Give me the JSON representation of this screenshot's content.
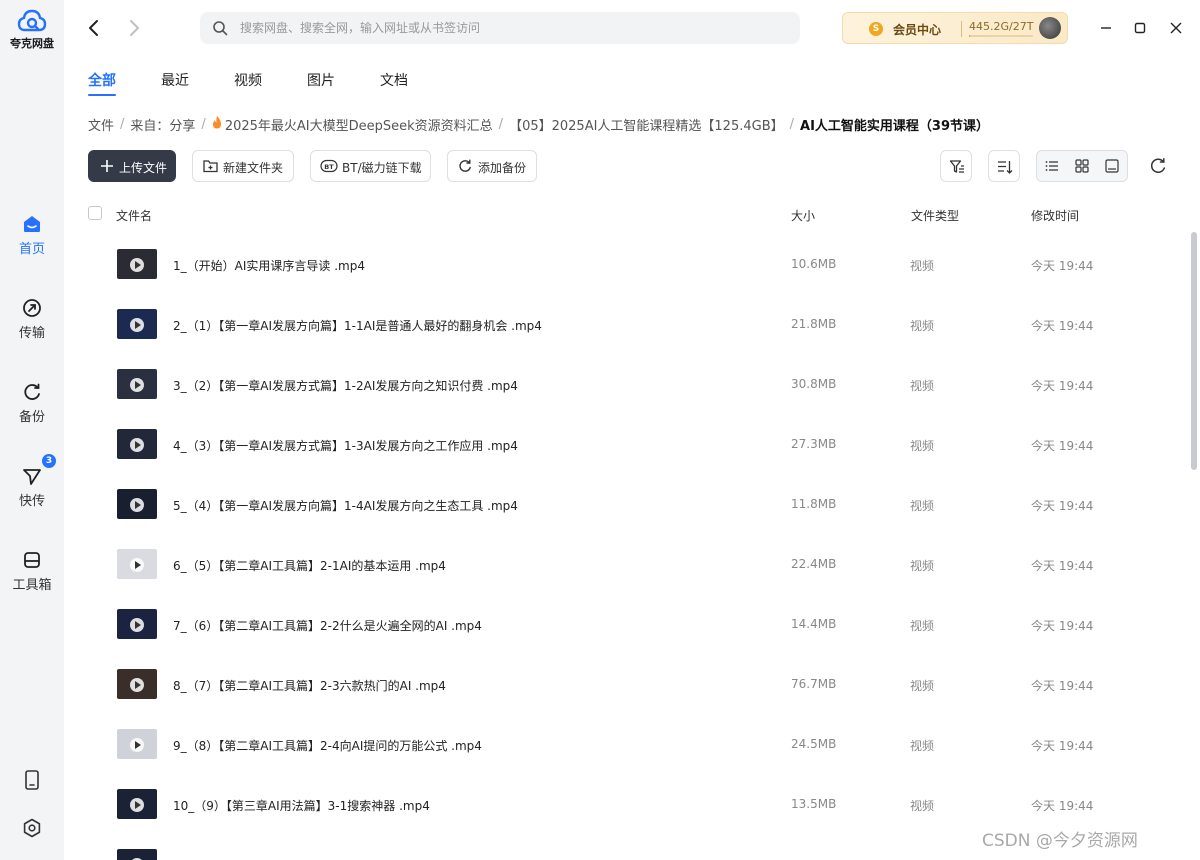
{
  "app": {
    "name": "夸克网盘"
  },
  "sidebar": {
    "items": [
      {
        "label": "首页",
        "icon": "home-icon",
        "active": true
      },
      {
        "label": "传输",
        "icon": "transfer-icon"
      },
      {
        "label": "备份",
        "icon": "backup-icon"
      },
      {
        "label": "快传",
        "icon": "quick-send-icon",
        "badge": "3"
      },
      {
        "label": "工具箱",
        "icon": "toolbox-icon"
      }
    ],
    "bottom": [
      {
        "icon": "phone-icon"
      },
      {
        "icon": "settings-icon"
      }
    ]
  },
  "topbar": {
    "search_placeholder": "搜索网盘、搜索全网，输入网址或从书签访问",
    "member_label": "会员中心",
    "member_badge": "S",
    "quota": "445.2G/27T",
    "quota_used_fraction": 0.016
  },
  "tabs": [
    "全部",
    "最近",
    "视频",
    "图片",
    "文档"
  ],
  "breadcrumb": {
    "root": "文件",
    "source": "来自：分享",
    "level1": "2025年最火AI大模型DeepSeek资源资料汇总",
    "level2": "【05】2025AI人工智能课程精选【125.4GB】",
    "current": "AI人工智能实用课程（39节课）"
  },
  "toolbar": {
    "upload": "上传文件",
    "new_folder": "新建文件夹",
    "bt_download": "BT/磁力链下载",
    "add_backup": "添加备份"
  },
  "table": {
    "headers": {
      "name": "文件名",
      "size": "大小",
      "type": "文件类型",
      "modified": "修改时间"
    },
    "rows": [
      {
        "name": "1_（开始）AI实用课序言导读  .mp4",
        "size": "10.6MB",
        "type": "视频",
        "modified": "今天 19:44",
        "thumb": "#2b2b33"
      },
      {
        "name": "2_（1）【第一章AI发展方向篇】1-1AI是普通人最好的翻身机会  .mp4",
        "size": "21.8MB",
        "type": "视频",
        "modified": "今天 19:44",
        "thumb": "#1c2a52"
      },
      {
        "name": "3_（2）【第一章AI发展方式篇】1-2AI发展方向之知识付费  .mp4",
        "size": "30.8MB",
        "type": "视频",
        "modified": "今天 19:44",
        "thumb": "#2a3040"
      },
      {
        "name": "4_（3）【第一章AI发展方式篇】1-3AI发展方向之工作应用  .mp4",
        "size": "27.3MB",
        "type": "视频",
        "modified": "今天 19:44",
        "thumb": "#22283a"
      },
      {
        "name": "5_（4）【第一章AI发展方向篇】1-4AI发展方向之生态工具  .mp4",
        "size": "11.8MB",
        "type": "视频",
        "modified": "今天 19:44",
        "thumb": "#1a1f30"
      },
      {
        "name": "6_（5）【第二章AI工具篇】2-1AI的基本运用  .mp4",
        "size": "22.4MB",
        "type": "视频",
        "modified": "今天 19:44",
        "thumb": "#d9dbe0"
      },
      {
        "name": "7_（6）【第二章AI工具篇】2-2什么是火遍全网的AI  .mp4",
        "size": "14.4MB",
        "type": "视频",
        "modified": "今天 19:44",
        "thumb": "#1b2340"
      },
      {
        "name": "8_（7）【第二章AI工具篇】2-3六款热门的AI  .mp4",
        "size": "76.7MB",
        "type": "视频",
        "modified": "今天 19:44",
        "thumb": "#3a2e2a"
      },
      {
        "name": "9_（8）【第二章AI工具篇】2-4向AI提问的万能公式  .mp4",
        "size": "24.5MB",
        "type": "视频",
        "modified": "今天 19:44",
        "thumb": "#cfd2d8"
      },
      {
        "name": "10_（9）【第三章AI用法篇】3-1搜索神器  .mp4",
        "size": "13.5MB",
        "type": "视频",
        "modified": "今天 19:44",
        "thumb": "#1c2236"
      },
      {
        "name": "",
        "size": "",
        "type": "",
        "modified": "",
        "thumb": "#1c2236"
      }
    ]
  },
  "watermark": "CSDN @今夕资源网"
}
